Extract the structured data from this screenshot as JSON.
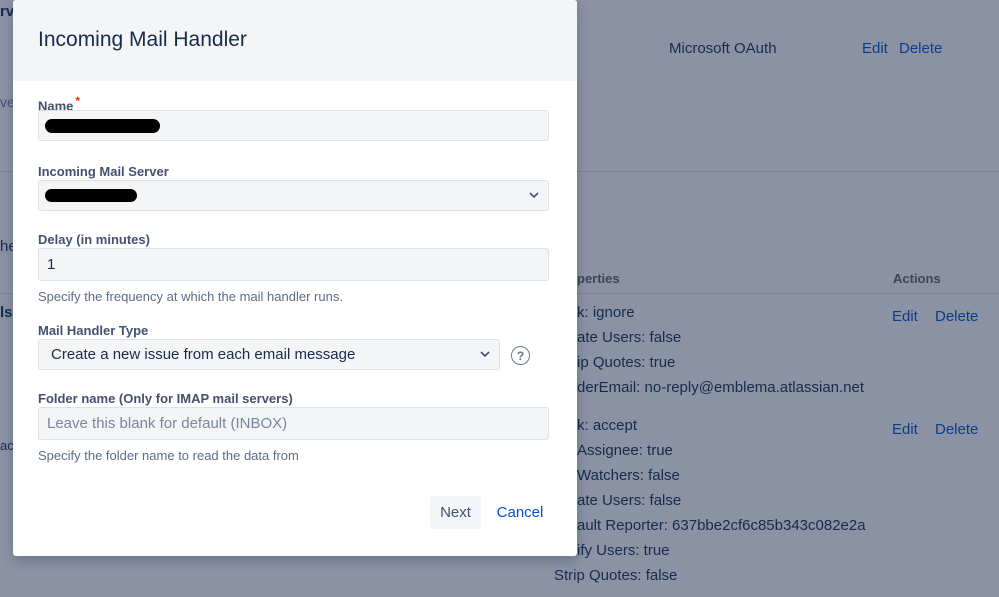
{
  "background": {
    "left_fragments": [
      "rv",
      "ve",
      "he",
      "ls",
      "ac"
    ],
    "server_row": {
      "type": "Microsoft OAuth",
      "edit": "Edit",
      "delete": "Delete"
    },
    "table_headers": {
      "properties": "perties",
      "actions": "Actions"
    },
    "handler_1": {
      "lines": [
        "k: ignore",
        "ate Users: false",
        "ip Quotes: true",
        "derEmail: no-reply@emblema.atlassian.net"
      ],
      "edit": "Edit",
      "delete": "Delete"
    },
    "handler_2": {
      "lines": [
        "k: accept",
        "Assignee: true",
        "Watchers: false",
        "ate Users: false",
        "ault Reporter: 637bbe2cf6c85b343c082e2a",
        "ify Users: true",
        "Strip Quotes: false"
      ],
      "edit": "Edit",
      "delete": "Delete"
    }
  },
  "modal": {
    "title": "Incoming Mail Handler",
    "name_field": {
      "label": "Name",
      "required_marker": "*"
    },
    "server_field": {
      "label": "Incoming Mail Server"
    },
    "delay_field": {
      "label": "Delay (in minutes)",
      "value": "1",
      "help": "Specify the frequency at which the mail handler runs."
    },
    "handler_type_field": {
      "label": "Mail Handler Type",
      "selected": "Create a new issue from each email message",
      "help_icon": "question-circle-icon"
    },
    "folder_field": {
      "label": "Folder name (Only for IMAP mail servers)",
      "placeholder": "Leave this blank for default (INBOX)",
      "help": "Specify the folder name to read the data from"
    },
    "buttons": {
      "next": "Next",
      "cancel": "Cancel"
    }
  }
}
